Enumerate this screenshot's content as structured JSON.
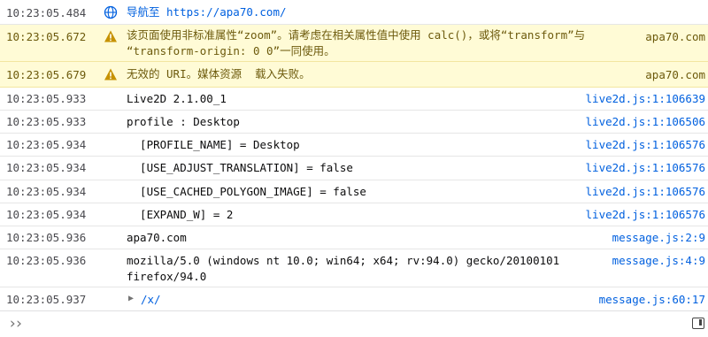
{
  "rows": [
    {
      "time": "10:23:05.484",
      "message": "导航至 https://apa70.com/",
      "nav_prefix": "导航至 ",
      "nav_url": "https://apa70.com/",
      "source": ""
    },
    {
      "time": "10:23:05.672",
      "message": "该页面使用非标准属性“zoom”。请考虑在相关属性值中使用 calc()，或将“transform”与\n“transform-origin: 0 0”一同使用。",
      "source": "apa70.com"
    },
    {
      "time": "10:23:05.679",
      "message": "无效的 URI。媒体资源  载入失败。",
      "source": "apa70.com"
    },
    {
      "time": "10:23:05.933",
      "message": "Live2D 2.1.00_1",
      "source": "live2d.js:1:106639"
    },
    {
      "time": "10:23:05.933",
      "message": "profile : Desktop",
      "source": "live2d.js:1:106506"
    },
    {
      "time": "10:23:05.934",
      "message": "  [PROFILE_NAME] = Desktop",
      "source": "live2d.js:1:106576"
    },
    {
      "time": "10:23:05.934",
      "message": "  [USE_ADJUST_TRANSLATION] = false",
      "source": "live2d.js:1:106576"
    },
    {
      "time": "10:23:05.934",
      "message": "  [USE_CACHED_POLYGON_IMAGE] = false",
      "source": "live2d.js:1:106576"
    },
    {
      "time": "10:23:05.934",
      "message": "  [EXPAND_W] = 2",
      "source": "live2d.js:1:106576"
    },
    {
      "time": "10:23:05.936",
      "message": "apa70.com",
      "source": "message.js:2:9"
    },
    {
      "time": "10:23:05.936",
      "message": "mozilla/5.0 (windows nt 10.0; win64; x64; rv:94.0) gecko/20100101\nfirefox/94.0",
      "source": "message.js:4:9"
    },
    {
      "time": "10:23:05.937",
      "message": "/x/",
      "source": "message.js:60:17"
    }
  ],
  "icons": {
    "navigate": "globe-icon",
    "warning": "warning-icon",
    "expand": "triangle-right-icon",
    "prompt": "double-chevron-icon",
    "sidebar": "sidebar-toggle-icon"
  },
  "colors": {
    "warning_bg": "#fffbd6",
    "link": "#0060df",
    "warning_icon": "#c69200"
  }
}
